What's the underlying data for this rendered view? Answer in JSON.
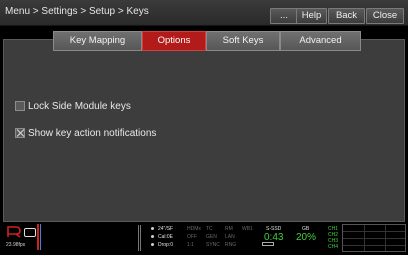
{
  "titlebar": {
    "breadcrumb": "Menu > Settings > Setup > Keys",
    "buttons": {
      "ellipsis": "...",
      "help": "Help",
      "back": "Back",
      "close": "Close"
    }
  },
  "tabs": [
    {
      "label": "Key Mapping",
      "active": false
    },
    {
      "label": "Options",
      "active": true
    },
    {
      "label": "Soft Keys",
      "active": false
    },
    {
      "label": "Advanced",
      "active": false
    }
  ],
  "options": [
    {
      "label": "Lock Side Module keys",
      "checked": false
    },
    {
      "label": "Show key action notifications",
      "checked": true
    }
  ],
  "status": {
    "fps": "23.98fps",
    "left_meta": [
      "24\"/SF",
      "Cal:0E",
      "Drop:0"
    ],
    "col2_top": [
      "HDMx",
      "TC",
      "RM",
      "WB1"
    ],
    "col2_mid": [
      "OFF",
      "GEN",
      "LAN"
    ],
    "col2_bot": [
      "1:1",
      "SYNC",
      "RNG"
    ],
    "media_label": "S-SSD",
    "media_time": "0:43",
    "gb_label": "GB",
    "gb_value": "20%",
    "channels": [
      "CH1",
      "CH2",
      "CH3",
      "CH4"
    ],
    "colors": {
      "logo_red": "#cc2222",
      "ok_green": "#3fd23f",
      "active_tab": "#b31b1b"
    }
  }
}
